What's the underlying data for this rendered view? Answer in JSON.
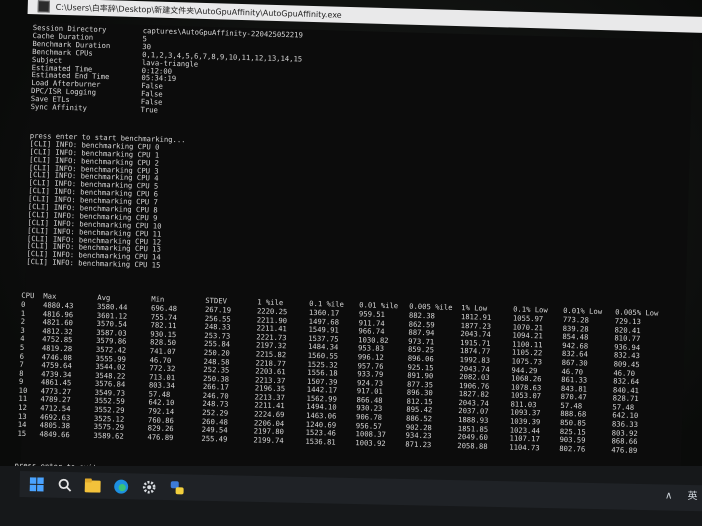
{
  "window": {
    "title": "C:\\Users\\白率辞\\Desktop\\新建文件夹\\AutoGpuAffinity\\AutoGpuAffinity.exe"
  },
  "settings": [
    {
      "key": "Session Directory",
      "value": "captures\\AutoGpuAffinity-220425052219"
    },
    {
      "key": "Cache Duration",
      "value": "5"
    },
    {
      "key": "Benchmark Duration",
      "value": "30"
    },
    {
      "key": "Benchmark CPUs",
      "value": "0,1,2,3,4,5,6,7,8,9,10,11,12,13,14,15"
    },
    {
      "key": "Subject",
      "value": "lava-triangle"
    },
    {
      "key": "Estimated Time",
      "value": "0:12:00"
    },
    {
      "key": "Estimated End Time",
      "value": "05:34:19"
    },
    {
      "key": "Load Afterburner",
      "value": "False"
    },
    {
      "key": "DPC/ISR Logging",
      "value": "False"
    },
    {
      "key": "Save ETLs",
      "value": "False"
    },
    {
      "key": "Sync Affinity",
      "value": "True"
    }
  ],
  "log": [
    "press enter to start benchmarking...",
    "[CLI] INFO: benchmarking CPU 0",
    "[CLI] INFO: benchmarking CPU 1",
    "[CLI] INFO: benchmarking CPU 2",
    "[CLI] INFO: benchmarking CPU 3",
    "[CLI] INFO: benchmarking CPU 4",
    "[CLI] INFO: benchmarking CPU 5",
    "[CLI] INFO: benchmarking CPU 6",
    "[CLI] INFO: benchmarking CPU 7",
    "[CLI] INFO: benchmarking CPU 8",
    "[CLI] INFO: benchmarking CPU 9",
    "[CLI] INFO: benchmarking CPU 10",
    "[CLI] INFO: benchmarking CPU 11",
    "[CLI] INFO: benchmarking CPU 12",
    "[CLI] INFO: benchmarking CPU 13",
    "[CLI] INFO: benchmarking CPU 14",
    "[CLI] INFO: benchmarking CPU 15"
  ],
  "table": {
    "headers": [
      "CPU",
      "Max",
      "Avg",
      "Min",
      "STDEV",
      "1 %ile",
      "0.1 %ile",
      "0.01 %ile",
      "0.005 %ile",
      "1% Low",
      "0.1% Low",
      "0.01% Low",
      "0.005% Low"
    ],
    "rows": [
      [
        "0",
        "4880.43",
        "3580.44",
        "696.48",
        "267.19",
        "2220.25",
        "1360.17",
        "959.51",
        "882.38",
        "1812.91",
        "1055.97",
        "773.28",
        "729.13"
      ],
      [
        "1",
        "4816.96",
        "3601.12",
        "755.74",
        "256.55",
        "2211.90",
        "1497.68",
        "911.74",
        "862.59",
        "1877.23",
        "1070.21",
        "839.28",
        "820.41"
      ],
      [
        "2",
        "4821.60",
        "3570.54",
        "782.11",
        "248.33",
        "2211.41",
        "1549.91",
        "966.74",
        "887.94",
        "2043.74",
        "1094.21",
        "854.48",
        "810.77"
      ],
      [
        "3",
        "4812.32",
        "3587.03",
        "930.15",
        "253.73",
        "2221.73",
        "1537.75",
        "1030.82",
        "973.71",
        "1915.71",
        "1100.11",
        "942.68",
        "936.94"
      ],
      [
        "4",
        "4752.85",
        "3579.86",
        "828.50",
        "255.84",
        "2197.32",
        "1484.34",
        "953.83",
        "859.25",
        "1874.77",
        "1105.22",
        "832.64",
        "832.43"
      ],
      [
        "5",
        "4819.28",
        "3572.42",
        "741.07",
        "250.20",
        "2215.82",
        "1560.55",
        "996.12",
        "896.06",
        "1992.83",
        "1075.73",
        "867.30",
        "809.45"
      ],
      [
        "6",
        "4746.08",
        "3555.99",
        "46.70",
        "248.58",
        "2218.77",
        "1525.32",
        "957.76",
        "925.15",
        "2043.74",
        "944.29",
        "46.70",
        "46.70"
      ],
      [
        "7",
        "4759.64",
        "3544.02",
        "772.32",
        "252.35",
        "2203.61",
        "1556.18",
        "933.79",
        "891.90",
        "2082.03",
        "1068.26",
        "861.33",
        "832.64"
      ],
      [
        "8",
        "4739.34",
        "3548.22",
        "713.01",
        "250.38",
        "2213.37",
        "1507.39",
        "924.73",
        "877.35",
        "1906.76",
        "1078.63",
        "843.81",
        "840.41"
      ],
      [
        "9",
        "4861.45",
        "3576.84",
        "803.34",
        "266.17",
        "2196.35",
        "1442.17",
        "917.01",
        "896.30",
        "1827.82",
        "1053.07",
        "870.47",
        "828.71"
      ],
      [
        "10",
        "4773.27",
        "3549.73",
        "57.48",
        "246.70",
        "2213.37",
        "1562.99",
        "866.48",
        "812.15",
        "2043.74",
        "811.03",
        "57.48",
        "57.48"
      ],
      [
        "11",
        "4789.27",
        "3552.59",
        "642.10",
        "248.73",
        "2211.41",
        "1494.10",
        "930.23",
        "895.42",
        "2037.07",
        "1093.37",
        "888.68",
        "642.10"
      ],
      [
        "12",
        "4712.54",
        "3552.29",
        "792.14",
        "252.29",
        "2224.69",
        "1463.06",
        "906.78",
        "886.52",
        "1888.93",
        "1039.39",
        "850.85",
        "836.33"
      ],
      [
        "13",
        "4692.63",
        "3525.12",
        "760.86",
        "260.48",
        "2206.04",
        "1240.69",
        "956.57",
        "902.28",
        "1851.85",
        "1023.44",
        "825.15",
        "803.92"
      ],
      [
        "14",
        "4805.38",
        "3575.29",
        "829.26",
        "249.54",
        "2197.80",
        "1523.46",
        "1008.37",
        "934.23",
        "2049.60",
        "1107.17",
        "903.59",
        "868.66"
      ],
      [
        "15",
        "4849.66",
        "3589.62",
        "476.89",
        "255.49",
        "2199.74",
        "1536.81",
        "1003.92",
        "871.23",
        "2058.88",
        "1104.73",
        "802.76",
        "476.89"
      ]
    ],
    "highlights": {
      "green": [
        "0-1",
        "1-2",
        "3-3",
        "3-7",
        "3-8",
        "3-11",
        "3-12",
        "4-11",
        "7-9",
        "9-1",
        "10-4",
        "10-6",
        "12-5",
        "14-10"
      ],
      "yellow": [
        "0-2",
        "2-4",
        "3-5",
        "4-10",
        "5-6",
        "14-3",
        "14-7",
        "14-8",
        "14-9",
        "14-11",
        "14-12",
        "15-2",
        "15-9"
      ]
    }
  },
  "prompt_exit": "press enter to exit",
  "taskbar": {
    "icons": [
      "windows-start-icon",
      "search-icon",
      "file-explorer-icon",
      "edge-browser-icon",
      "settings-gear-icon",
      "python-app-icon"
    ],
    "tray": {
      "chevron": "∧",
      "lang": "英"
    }
  }
}
